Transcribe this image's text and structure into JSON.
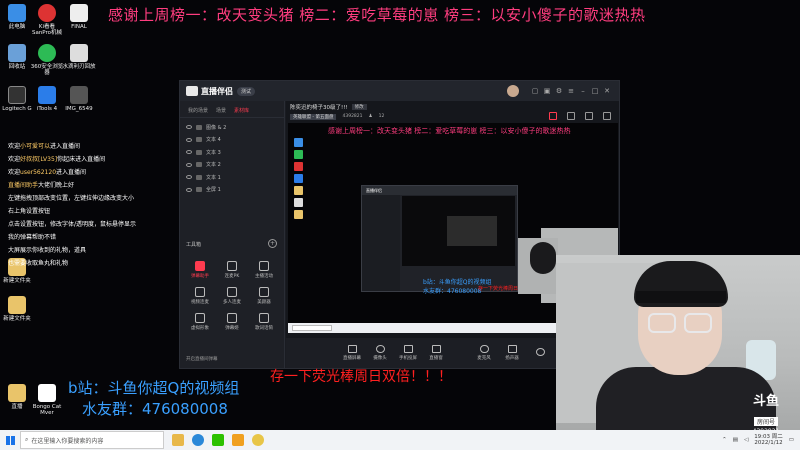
{
  "overlay": {
    "thanks_banner": "感谢上周榜一：改天变头猪 榜二：爱吃草莓的崽 榜三：以安小傻子的歌迷热热",
    "bili_line": "b站：斗鱼你超Q的视频组",
    "qq_group_line": "水友群：476080008",
    "promo_line": "存一下荧光棒周日双倍！！！"
  },
  "desktop_icons": [
    {
      "label": "此电脑",
      "color": "#3a8ee6"
    },
    {
      "label": "Ki看看 SanPro机械",
      "color": "#d33"
    },
    {
      "label": "FINAL",
      "color": "#eee"
    },
    {
      "label": "回收站",
      "color": "#6aa0d8"
    },
    {
      "label": "360安全浏览器",
      "color": "#2dbb55"
    },
    {
      "label": "水滴利刃回放",
      "color": "#ddd"
    },
    {
      "label": "Logitech G",
      "color": "#333"
    },
    {
      "label": "iTools 4",
      "color": "#2b7de9"
    },
    {
      "label": "IMG_6549",
      "color": "#555"
    },
    {
      "label": "新建文件夹",
      "color": "#e9c46a"
    },
    {
      "label": "新建文件夹",
      "color": "#e9c46a"
    },
    {
      "label": "直播",
      "color": "#e9c46a"
    },
    {
      "label": "Bongo Cat Mver",
      "color": "#fff"
    }
  ],
  "chat_lines": [
    {
      "pre": "欢迎",
      "name": "小可爱可以",
      "post": "进入直播间"
    },
    {
      "pre": "欢迎",
      "name": "好叔叔[LV35]",
      "post": "你起床进入直播间"
    },
    {
      "pre": "欢迎",
      "name": "user562120",
      "post": "进入直播间"
    },
    {
      "pre": "",
      "name": "直播间助手",
      "post": "大佬们晚上好"
    },
    {
      "pre": "",
      "name": "",
      "post": "左键拖拽顶部改变位置，左键拉伸边缘改变大小"
    },
    {
      "pre": "",
      "name": "",
      "post": "右上角设置按钮"
    },
    {
      "pre": "",
      "name": "",
      "post": "点击设置按钮，修改字体/透明度，鼠标悬停显示"
    },
    {
      "pre": "",
      "name": "",
      "post": "我的弹幕帮助不错"
    },
    {
      "pre": "",
      "name": "",
      "post": "大屏展示你收到的礼物，道具"
    },
    {
      "pre": "",
      "name": "",
      "post": "也需要收取鱼丸和礼物"
    }
  ],
  "app": {
    "name": "直播伴侣",
    "version_badge": "测试",
    "source_tabs": [
      "我的场景",
      "场景",
      "素材库"
    ],
    "active_source_tab": 2,
    "sources": [
      "图像 & 2",
      "文本 4",
      "文本 3",
      "文本 2",
      "文本 1",
      "全屏 1"
    ],
    "tools_header": "工具箱",
    "tools": [
      {
        "label": "弹幕助手",
        "active": true
      },
      {
        "label": "连麦PK",
        "active": false
      },
      {
        "label": "主播活动",
        "active": false
      },
      {
        "label": "视频连麦",
        "active": false
      },
      {
        "label": "多人连麦",
        "active": false
      },
      {
        "label": "美颜器",
        "active": false
      },
      {
        "label": "虚拟形象",
        "active": false
      },
      {
        "label": "弹幕姬",
        "active": false
      },
      {
        "label": "歌词话筒",
        "active": false
      }
    ],
    "left_footer": "开启直播间弹幕",
    "room_title": "陈奕迅的椅子30级了!!!",
    "modify_label": "修改",
    "category": "英雄联盟 - 第五面盘",
    "room_id": "4392821",
    "viewer_count": "12",
    "preview": {
      "banner": "感谢上周榜一：改天变头猪 榜二：爱吃草莓的崽 榜三：以安小傻子的歌迷热热",
      "bili": "b站：斗鱼你超Q的视频组",
      "qq": "水友群：476080008",
      "promo": "存一下荧光棒周日双倍！！！"
    },
    "controls": [
      "直播屏幕",
      "摄像头",
      "手机投屏",
      "直播窗",
      "麦克风",
      "扬声器"
    ]
  },
  "cam": {
    "platform_logo": "斗鱼",
    "platform_label": "房间号",
    "room_number": "4392821"
  },
  "taskbar": {
    "search_placeholder": "在这里输入你要搜索的内容",
    "apps": [
      {
        "name": "file-explorer",
        "color": "#e8b84a"
      },
      {
        "name": "edge",
        "color": "#2b88d8"
      },
      {
        "name": "wechat",
        "color": "#2dc100"
      },
      {
        "name": "douyu",
        "color": "#f0a020"
      },
      {
        "name": "chrome",
        "color": "#e8c547"
      }
    ],
    "time": "19:03 周二",
    "date": "2022/1/12"
  }
}
